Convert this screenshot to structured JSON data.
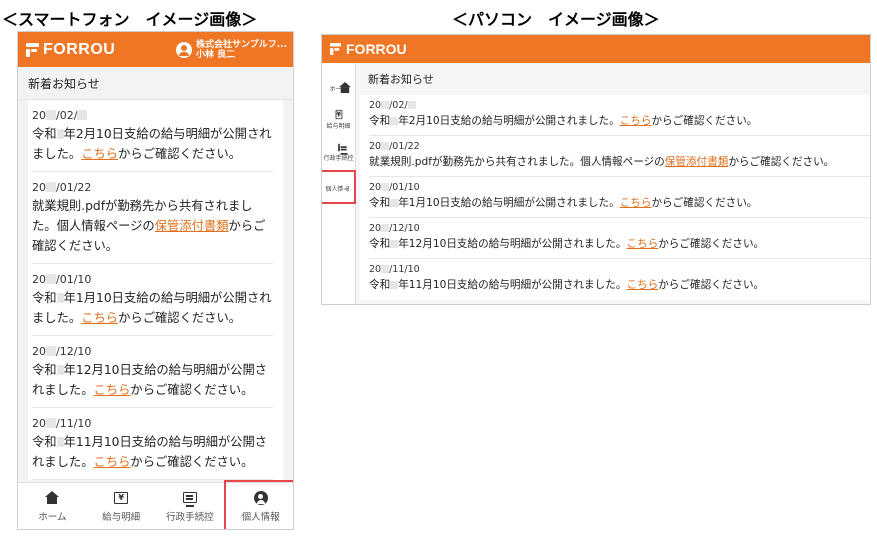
{
  "captions": {
    "smartphone": "＜スマートフォン　イメージ画像＞",
    "pc": "＜パソコン　イメージ画像＞"
  },
  "brand": "FORROU",
  "user": {
    "company": "株式会社サンプルフ...",
    "name": "小林 良二"
  },
  "section_title": "新着お知らせ",
  "link_kochira": "こちら",
  "link_hokan": "保管添付書類",
  "notices": [
    {
      "date_a": "20",
      "date_b": "/02/",
      "t1": "令和",
      "t2": "年2月10日支給の給与明細が公開されました。",
      "t3": "からご確認ください。"
    },
    {
      "date_a": "20",
      "date_b": "/01/22",
      "t1": "就業規則.pdfが勤務先から共有されました。個人情報ページの",
      "t3": "からご確認ください。"
    },
    {
      "date_a": "20",
      "date_b": "/01/10",
      "t1": "令和",
      "t2": "年1月10日支給の給与明細が公開されました。",
      "t3": "からご確認ください。"
    },
    {
      "date_a": "20",
      "date_b": "/12/10",
      "t1": "令和",
      "t2": "年12月10日支給の給与明細が公開されました。",
      "t3": "からご確認ください。"
    },
    {
      "date_a": "20",
      "date_b": "/11/10",
      "t1": "令和",
      "t2": "年11月10日支給の給与明細が公開されました。",
      "t3": "からご確認ください。"
    }
  ],
  "nav": {
    "home": "ホーム",
    "payslip": "給与明細",
    "admin": "行政手続控",
    "personal": "個人情報"
  },
  "colors": {
    "brand_orange": "#ee7624",
    "highlight_red": "#e7474c",
    "link_orange": "#e0701f"
  },
  "icons": [
    "home-icon",
    "yen-icon",
    "document-icon",
    "person-icon",
    "user-icon"
  ]
}
